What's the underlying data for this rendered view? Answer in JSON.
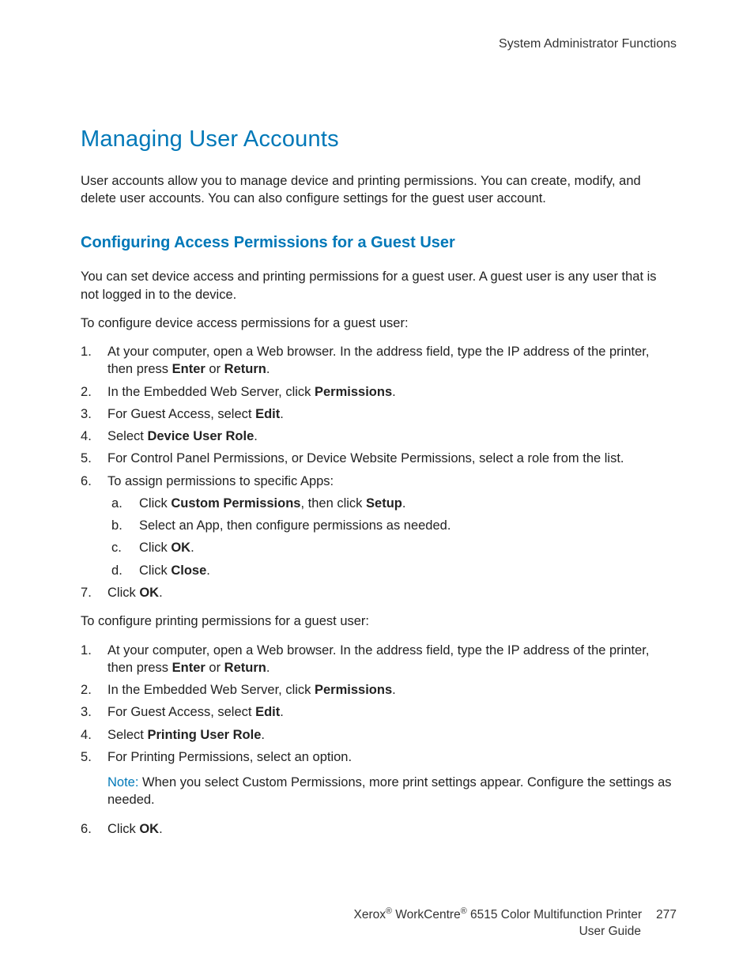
{
  "header": {
    "section": "System Administrator Functions"
  },
  "title": "Managing User Accounts",
  "intro": "User accounts allow you to manage device and printing permissions. You can create, modify, and delete user accounts. You can also configure settings for the guest user account.",
  "subheading": "Configuring Access Permissions for a Guest User",
  "sub_intro": "You can set device access and printing permissions for a guest user. A guest user is any user that is not logged in to the device.",
  "list1_lead": "To configure device access permissions for a guest user:",
  "list1": {
    "s1a": "At your computer, open a Web browser. In the address field, type the IP address of the printer, then press ",
    "s1b": "Enter",
    "s1c": " or ",
    "s1d": "Return",
    "s1e": ".",
    "s2a": "In the Embedded Web Server, click ",
    "s2b": "Permissions",
    "s2c": ".",
    "s3a": "For Guest Access, select ",
    "s3b": "Edit",
    "s3c": ".",
    "s4a": "Select ",
    "s4b": "Device User Role",
    "s4c": ".",
    "s5": "For Control Panel Permissions, or Device Website Permissions, select a role from the list.",
    "s6": "To assign permissions to specific Apps:",
    "s6a_1": "Click ",
    "s6a_2": "Custom Permissions",
    "s6a_3": ", then click ",
    "s6a_4": "Setup",
    "s6a_5": ".",
    "s6b": "Select an App, then configure permissions as needed.",
    "s6c_1": "Click ",
    "s6c_2": "OK",
    "s6c_3": ".",
    "s6d_1": "Click ",
    "s6d_2": "Close",
    "s6d_3": ".",
    "s7_1": "Click ",
    "s7_2": "OK",
    "s7_3": "."
  },
  "list2_lead": "To configure printing permissions for a guest user:",
  "list2": {
    "s1a": "At your computer, open a Web browser. In the address field, type the IP address of the printer, then press ",
    "s1b": "Enter",
    "s1c": " or ",
    "s1d": "Return",
    "s1e": ".",
    "s2a": "In the Embedded Web Server, click ",
    "s2b": "Permissions",
    "s2c": ".",
    "s3a": "For Guest Access, select ",
    "s3b": "Edit",
    "s3c": ".",
    "s4a": "Select ",
    "s4b": "Printing User Role",
    "s4c": ".",
    "s5": "For Printing Permissions, select an option.",
    "note_label": "Note:",
    "note_text": " When you select Custom Permissions, more print settings appear. Configure the settings as needed.",
    "s6_1": "Click ",
    "s6_2": "OK",
    "s6_3": "."
  },
  "footer": {
    "brand1": "Xerox",
    "reg": "®",
    "brand2": " WorkCentre",
    "model": " 6515 Color Multifunction Printer",
    "page": "277",
    "guide": "User Guide"
  }
}
